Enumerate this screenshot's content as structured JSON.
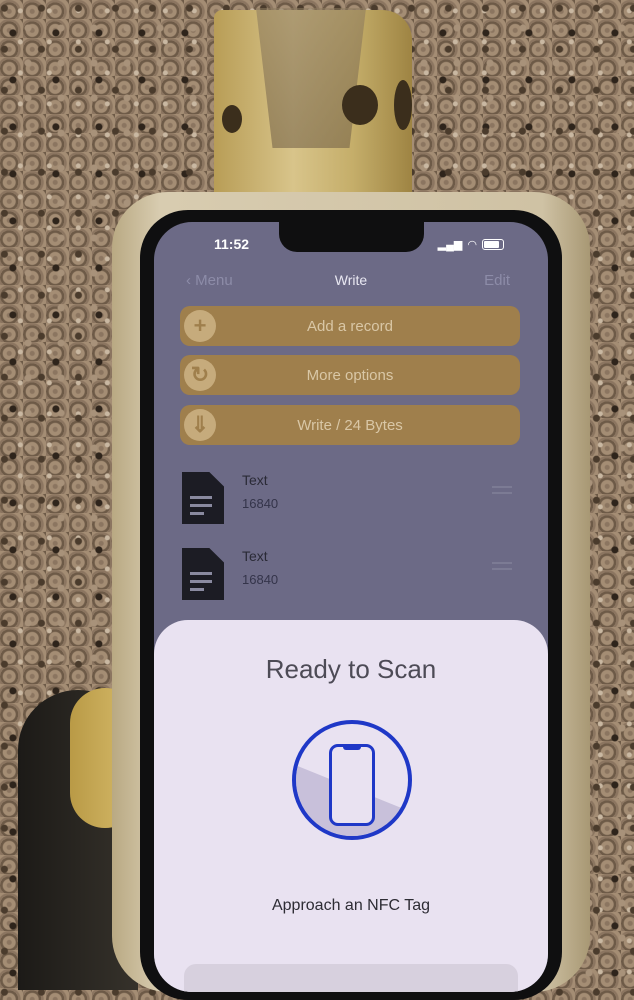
{
  "status_bar": {
    "time": "11:52"
  },
  "nav": {
    "back_label": "Menu",
    "title": "Write",
    "edit_label": "Edit"
  },
  "actions": [
    {
      "label": "Add a record",
      "icon": "plus-icon"
    },
    {
      "label": "More options",
      "icon": "settings-icon"
    },
    {
      "label": "Write / 24 Bytes",
      "icon": "download-icon"
    }
  ],
  "records": [
    {
      "type": "Text",
      "size": "16840"
    },
    {
      "type": "Text",
      "size": "16840"
    }
  ],
  "scan_sheet": {
    "title": "Ready to Scan",
    "message": "Approach an NFC Tag",
    "icon": "phone-icon"
  },
  "colors": {
    "accent": "#9f7f4c",
    "scan_blue": "#1f38c7"
  }
}
